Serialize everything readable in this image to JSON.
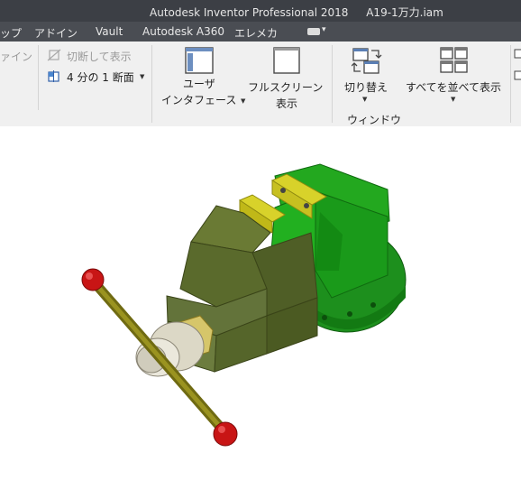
{
  "window": {
    "title_app": "Autodesk Inventor Professional 2018",
    "title_file": "A19-1万力.iam"
  },
  "tabs": [
    "ップ",
    "アドイン",
    "Vault",
    "Autodesk A360",
    "エレメカ"
  ],
  "ribbon": {
    "left_partial": "ァイン",
    "slice_show": "切断して表示",
    "quarter_section": "4 分の 1 断面",
    "user_interface_line1": "ユーザ",
    "user_interface_line2": "インタフェース",
    "full_screen_line1": "フルスクリーン",
    "full_screen_line2": "表示",
    "switch": "切り替え",
    "arrange_all": "すべてを並べて表示",
    "window_panel": "ウィンドウ"
  },
  "colors": {
    "titlebar": "#3c3f45",
    "tabbar": "#4a4d53",
    "ribbon": "#f0f0f0",
    "vise_body": "#5a6a2e",
    "vise_base": "#1f9a1f",
    "jaw_pads": "#d8d22a",
    "handle": "#7f7a1a",
    "handle_knobs": "#cc1a1a",
    "screw_collar": "#d6d2b8"
  },
  "icons": [
    "slice-icon",
    "quarter-section-icon",
    "user-interface-icon",
    "full-screen-icon",
    "switch-window-icon",
    "arrange-all-icon"
  ]
}
